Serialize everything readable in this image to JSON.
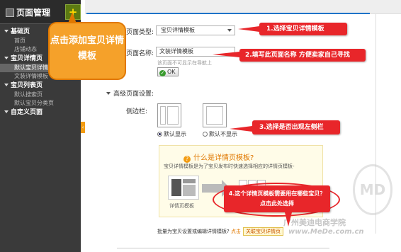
{
  "sidebar": {
    "title": "页面管理",
    "plus": "+",
    "sections": [
      {
        "label": "基础页",
        "items": [
          "首页",
          "店铺动态"
        ]
      },
      {
        "label": "宝贝详情页",
        "items": [
          "默认宝贝详情页",
          "文装详情模板"
        ]
      },
      {
        "label": "宝贝列表页",
        "items": [
          "默认搜索页",
          "默认宝贝分类页"
        ]
      },
      {
        "label": "自定义页面",
        "items": []
      }
    ],
    "active_item": "默认宝贝详情页"
  },
  "form": {
    "page_type_label": "页面类型:",
    "page_type_value": "宝贝详情模板",
    "page_name_label": "页面名称:",
    "page_name_value": "文装详情模板",
    "page_name_hint": "该页面不可显示在导航上",
    "ok_label": "OK",
    "advanced_label": "高级页面设置:",
    "sidebar_label": "侧边栏:",
    "radio_show": "默认显示",
    "radio_hide": "默认不显示",
    "radio_selected": "默认显示"
  },
  "info": {
    "title": "什么是详情页模板?",
    "desc": "宝贝详情模板是为了宝贝发布时快速选择相应的详情页模板-",
    "template_caption": "详情页模板",
    "bottom_text": "批量为宝贝设置或编辑详情模板?",
    "click_here": "点击",
    "link_button": "关联宝贝详情页"
  },
  "callouts": {
    "c0": "点击添加宝贝详情模板",
    "c1": "1.选择宝贝详情模板",
    "c2": "2.填写此页面名称 方便卖家自己寻找",
    "c3": "3.选择是否出现左侧栏",
    "c4_line1": "4.这个详情页模板需要用在哪些宝贝？",
    "c4_line2": "点击此处选择"
  },
  "watermark": {
    "line1": "广州美迪电商学院",
    "line2": "www.MeDe.com.cn",
    "logo": "MD"
  },
  "colors": {
    "callout_red": "#e8262a",
    "callout_orange": "#f5a12a",
    "sidebar_bg": "#3a3a3a"
  }
}
